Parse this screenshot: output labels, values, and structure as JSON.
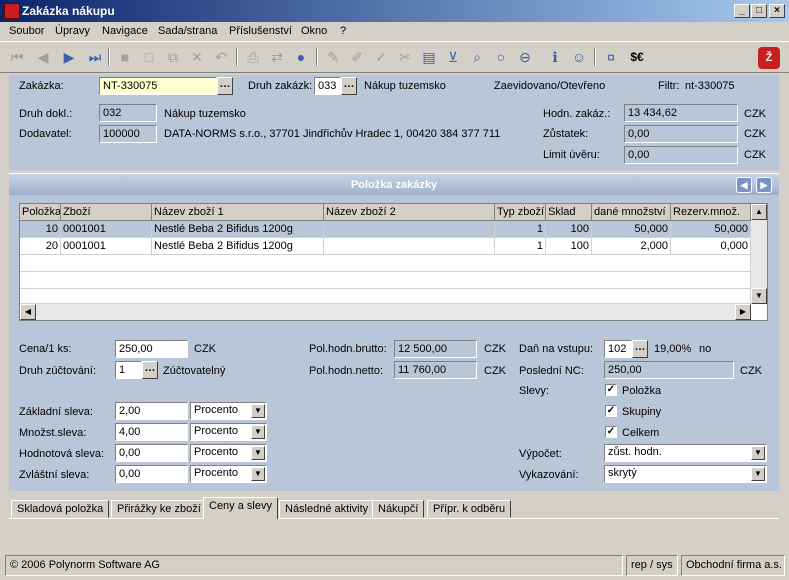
{
  "window": {
    "title": "Zakázka nákupu"
  },
  "menu": [
    "Soubor",
    "Úpravy",
    "Navigace",
    "Sada/strana",
    "Příslušenství",
    "Okno",
    "?"
  ],
  "toolbar": {
    "currency_label": "$€"
  },
  "header": {
    "zakazka_label": "Zakázka:",
    "zakazka_value": "NT-330075",
    "druh_zakazk_label": "Druh zakázk:",
    "druh_zakazk_value": "033",
    "druh_zakazk_text": "Nákup tuzemsko",
    "status_text": "Zaevidovano/Otevřeno",
    "filtr_label": "Filtr:",
    "filtr_value": "nt-330075",
    "druh_dokl_label": "Druh dokl.:",
    "druh_dokl_value": "032",
    "druh_dokl_text": "Nákup tuzemsko",
    "dodavatel_label": "Dodavatel:",
    "dodavatel_value": "100000",
    "dodavatel_text": "DATA-NORMS s.r.o., 37701 Jindřichův Hradec 1, 00420 384 377 711",
    "hodn_label": "Hodn. zakáz.:",
    "hodn_value": "13 434,62",
    "hodn_cur": "CZK",
    "zustatek_label": "Zůstatek:",
    "zustatek_value": "0,00",
    "zustatek_cur": "CZK",
    "limit_label": "Limit úvěru:",
    "limit_value": "0,00",
    "limit_cur": "CZK"
  },
  "section": {
    "title": "Položka zakázky"
  },
  "grid": {
    "columns": [
      "Položka",
      "Zboží",
      "Název zboží 1",
      "Název zboží 2",
      "Typ zboží",
      "Sklad",
      "dané množství",
      "Rezerv.množ."
    ],
    "rows": [
      [
        "10",
        "0001001",
        "Nestlé Beba 2 Bifidus 1200g",
        "",
        "1",
        "100",
        "50,000",
        "50,000"
      ],
      [
        "20",
        "0001001",
        "Nestlé Beba 2 Bifidus 1200g",
        "",
        "1",
        "100",
        "2,000",
        "0,000"
      ]
    ]
  },
  "detail": {
    "cena_label": "Cena/1 ks:",
    "cena_value": "250,00",
    "cena_cur": "CZK",
    "druh_zuct_label": "Druh zúčtování:",
    "druh_zuct_value": "1",
    "druh_zuct_text": "Zúčtovatelný",
    "brutto_label": "Pol.hodn.brutto:",
    "brutto_value": "12 500,00",
    "brutto_cur": "CZK",
    "netto_label": "Pol.hodn.netto:",
    "netto_value": "11 760,00",
    "netto_cur": "CZK",
    "dan_label": "Daň na vstupu:",
    "dan_value": "102",
    "dan_pct": "19,00%",
    "dan_no": "no",
    "posledni_label": "Poslední NC:",
    "posledni_value": "250,00",
    "posledni_cur": "CZK",
    "slevy_label": "Slevy:",
    "checks": [
      "Položka",
      "Skupiny",
      "Celkem"
    ],
    "discounts": [
      {
        "label": "Základní sleva:",
        "value": "2,00",
        "type": "Procento"
      },
      {
        "label": "Množst.sleva:",
        "value": "4,00",
        "type": "Procento"
      },
      {
        "label": "Hodnotová sleva:",
        "value": "0,00",
        "type": "Procento"
      },
      {
        "label": "Zvláštní sleva:",
        "value": "0,00",
        "type": "Procento"
      }
    ],
    "vypocet_label": "Výpočet:",
    "vypocet_value": "zůst. hodn.",
    "vykaz_label": "Vykazování:",
    "vykaz_value": "skrytý"
  },
  "tabs": [
    "Skladová položka",
    "Přirážky ke zboží",
    "Ceny a slevy",
    "Následné aktivity",
    "Nákupčí",
    "Přípr. k odběru"
  ],
  "status": {
    "copyright": "© 2006 Polynorm Software AG",
    "user": "rep / sys",
    "company": "Obchodní firma a.s."
  }
}
